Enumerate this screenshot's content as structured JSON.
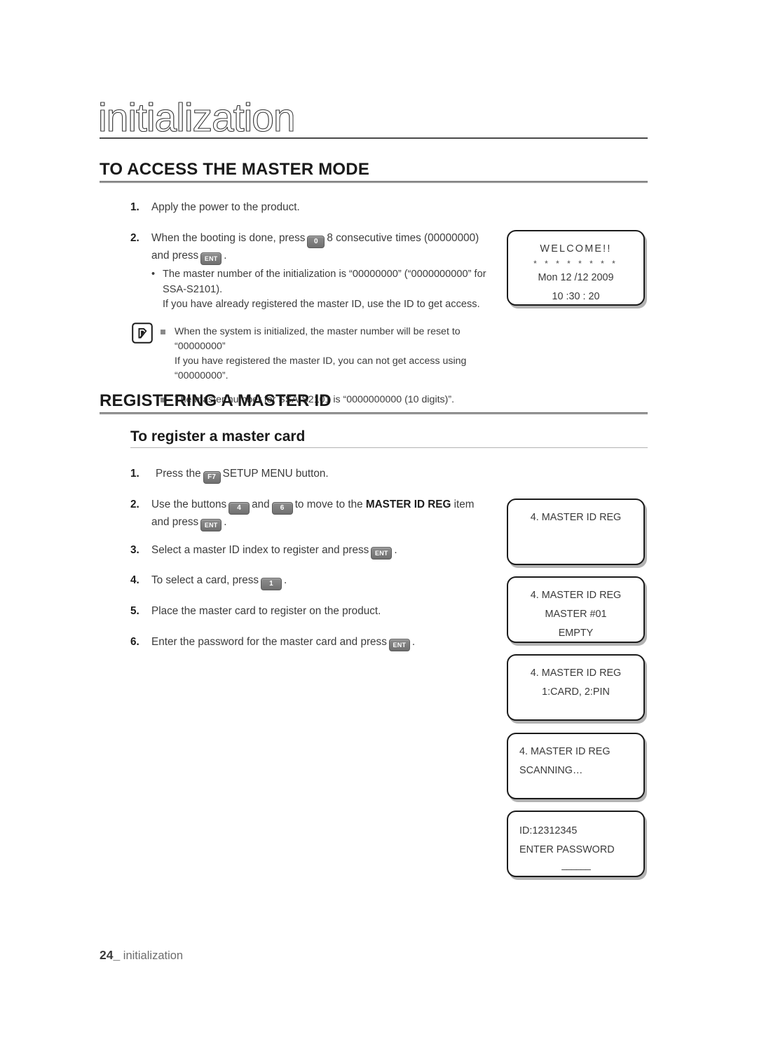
{
  "chapter": {
    "title": "initialization"
  },
  "sections": {
    "access": {
      "heading": "TO ACCESS THE MASTER MODE",
      "steps": [
        {
          "num": "1.",
          "text": "Apply the power to the product."
        },
        {
          "num": "2.",
          "text_a": "When the booting is done, press",
          "key_1": "0",
          "text_b": "8 consecutive times (00000000) and press",
          "key_2": "ENT",
          "text_c": "."
        }
      ],
      "sub_bullets": [
        {
          "dot": "•",
          "line_1": "The master number of the initialization is “00000000” (“0000000000” for",
          "line_2": "SSA-S2101).",
          "line_3": "If you have already registered the master ID, use the ID to get access."
        }
      ],
      "note": {
        "icon": "note-pencil-icon",
        "items": [
          {
            "line_1": "When the system is initialized, the master number will be reset to “00000000”",
            "line_2": "If you have registered the master ID, you can not get access using “00000000”."
          },
          {
            "line_1": "The master number for SSA-S2101 is “0000000000 (10 digits)”.",
            "line_2": ""
          }
        ]
      }
    },
    "registering": {
      "heading": "REGISTERING A MASTER ID",
      "sub_heading": "To register a master card",
      "steps": [
        {
          "num": "1.",
          "text_a": "Press the",
          "key_1": "F7",
          "text_b": "SETUP MENU button."
        },
        {
          "num": "2.",
          "text_a": "Use the buttons",
          "key_1": "4",
          "text_mid": "and",
          "key_2": "6",
          "text_b": "to move to the",
          "bold": "MASTER ID REG",
          "text_c": "item and press",
          "key_3": "ENT",
          "text_d": "."
        },
        {
          "num": "3.",
          "text_a": "Select a master ID index to register and press",
          "key_1": "ENT",
          "text_b": "."
        },
        {
          "num": "4.",
          "text_a": "To select a card, press",
          "key_1": "1",
          "text_b": "."
        },
        {
          "num": "5.",
          "text_a": "Place the master card to register on the product."
        },
        {
          "num": "6.",
          "text_a": "Enter the password for the master card and press",
          "key_1": "ENT",
          "text_b": "."
        }
      ]
    }
  },
  "displays": {
    "welcome": {
      "line_1": "WELCOME!!",
      "line_2": "* * * * * * * *",
      "line_3": "Mon 12 /12 2009",
      "line_4": "10 :30 : 20"
    },
    "master_id_reg_1": {
      "line_1": "4. MASTER ID REG",
      "line_2": "",
      "line_3": ""
    },
    "master_id_reg_2": {
      "line_1": "4. MASTER ID REG",
      "line_2": "MASTER #01",
      "line_3": "EMPTY"
    },
    "master_id_reg_3": {
      "line_1": "4. MASTER ID REG",
      "line_2": "1:CARD, 2:PIN",
      "line_3": ""
    },
    "master_id_reg_4": {
      "line_1": "4. MASTER ID REG",
      "line_2": "SCANNING…",
      "line_3": ""
    },
    "enter_password": {
      "line_1": "ID:12312345",
      "line_2": "ENTER PASSWORD",
      "line_3": "––––––"
    }
  },
  "footer": {
    "page_number": "24_",
    "label": "initialization"
  }
}
